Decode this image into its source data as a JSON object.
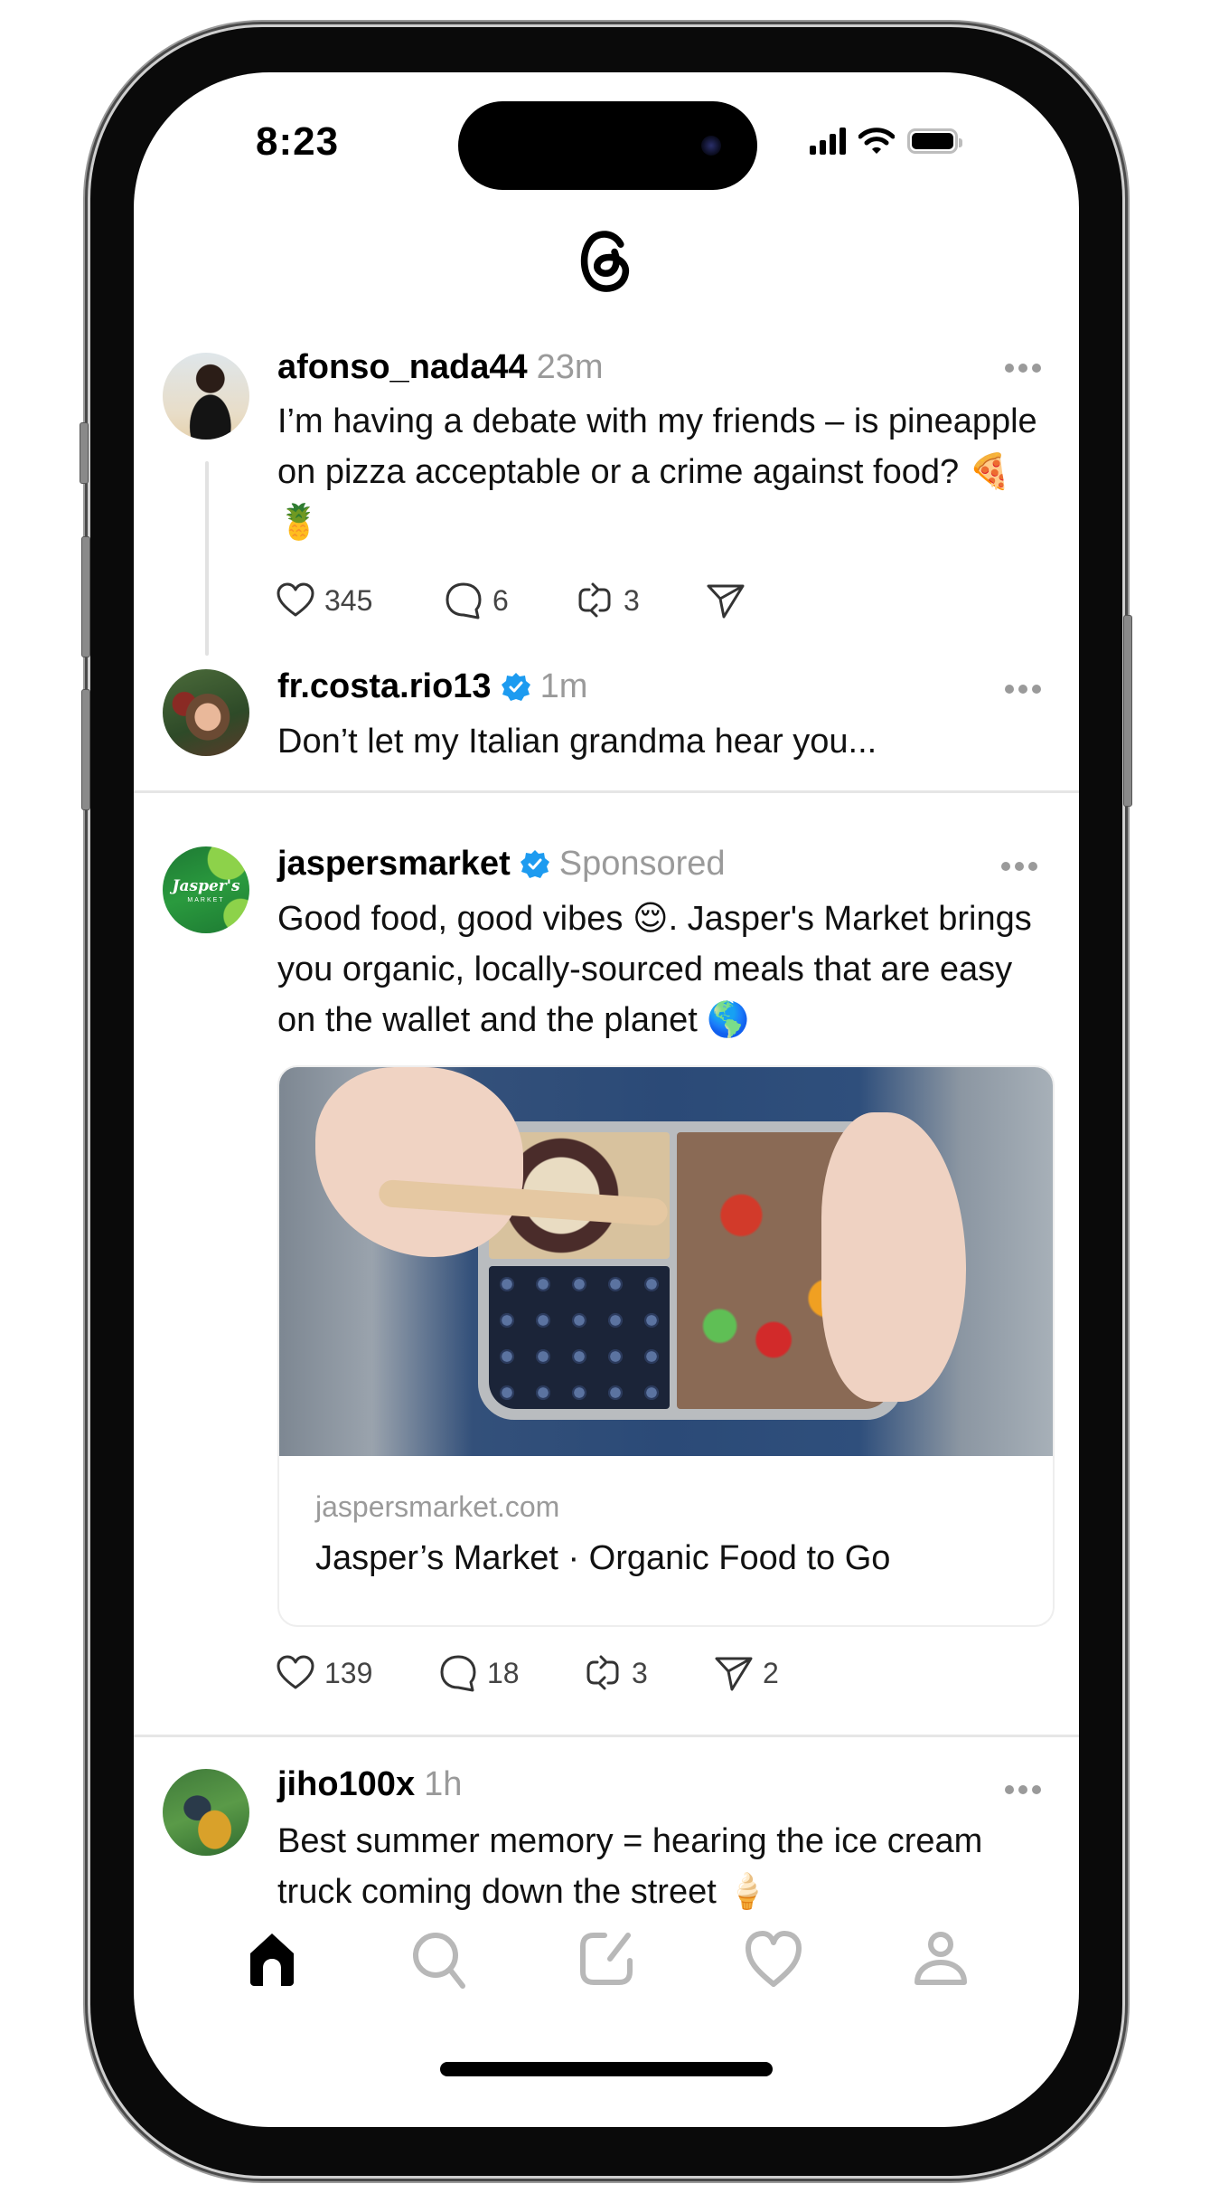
{
  "status_bar": {
    "time": "8:23",
    "icons": [
      "cellular-signal-icon",
      "wifi-icon",
      "battery-icon"
    ]
  },
  "app": {
    "name": "Threads",
    "logo_icon": "threads-logo-icon"
  },
  "feed": {
    "posts": [
      {
        "username": "afonso_nada44",
        "verified": false,
        "time": "23m",
        "text": "I’m having a debate with my friends – is pineapple on pizza acceptable or a crime against food? 🍕🍍",
        "likes": "345",
        "replies": "6",
        "reposts": "3",
        "shares": ""
      },
      {
        "username": "fr.costa.rio13",
        "verified": true,
        "time": "1m",
        "text": "Don’t let my Italian grandma hear you..."
      },
      {
        "username": "jaspersmarket",
        "verified": true,
        "time": "Sponsored",
        "avatar_text": "Jasper's",
        "avatar_subtext": "MARKET",
        "text": "Good food, good vibes 😌. Jasper's Market brings you organic, locally-sourced meals that are easy on the wallet and the planet 🌎",
        "link_domain": "jaspersmarket.com",
        "link_title": "Jasper’s Market · Organic Food to Go",
        "likes": "139",
        "replies": "18",
        "reposts": "3",
        "shares": "2"
      },
      {
        "username": "jiho100x",
        "verified": false,
        "time": "1h",
        "text": "Best summer memory = hearing the ice cream truck coming down the street 🍦"
      }
    ]
  },
  "tab_bar": {
    "items": [
      {
        "name": "home",
        "icon": "home-icon",
        "active": true
      },
      {
        "name": "search",
        "icon": "search-icon",
        "active": false
      },
      {
        "name": "compose",
        "icon": "compose-icon",
        "active": false
      },
      {
        "name": "activity",
        "icon": "heart-icon",
        "active": false
      },
      {
        "name": "profile",
        "icon": "profile-icon",
        "active": false
      }
    ]
  },
  "colors": {
    "verified": "#1d9bf0",
    "muted_text": "#9a9a9a",
    "inactive_icon": "#b8b8b8",
    "brand_green": "#1f8a3a"
  }
}
